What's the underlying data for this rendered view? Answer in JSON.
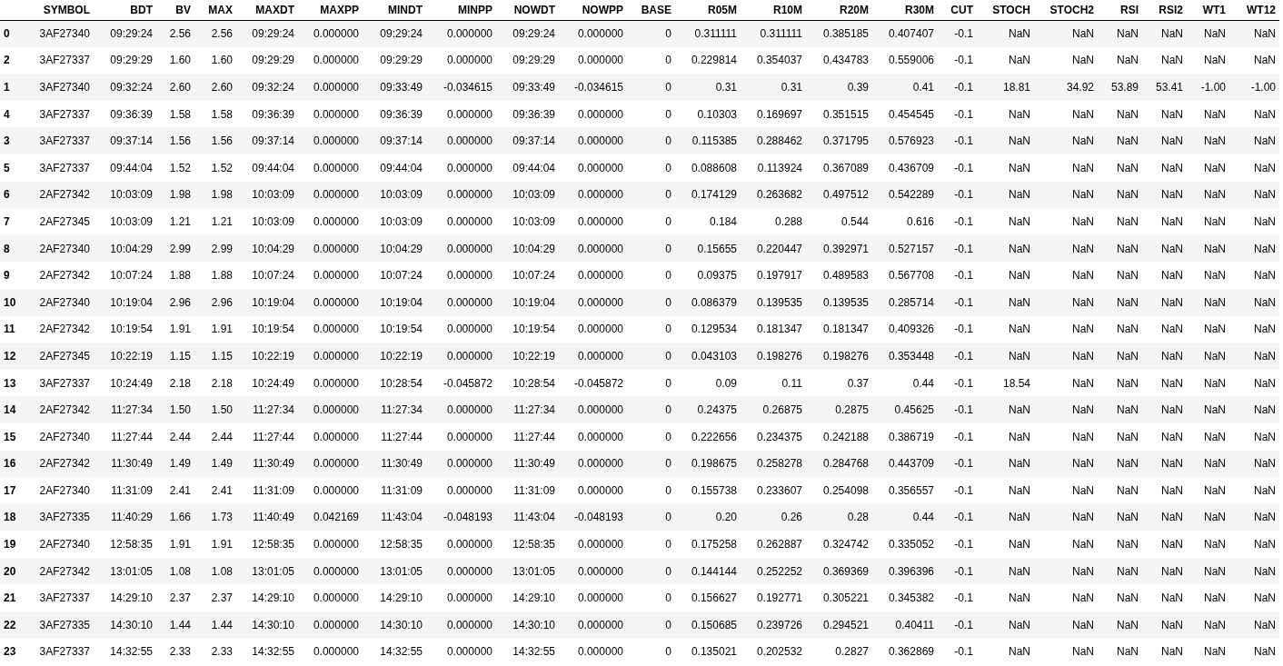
{
  "table": {
    "columns": [
      "SYMBOL",
      "BDT",
      "BV",
      "MAX",
      "MAXDT",
      "MAXPP",
      "MINDT",
      "MINPP",
      "NOWDT",
      "NOWPP",
      "BASE",
      "R05M",
      "R10M",
      "R20M",
      "R30M",
      "CUT",
      "STOCH",
      "STOCH2",
      "RSI",
      "RSI2",
      "WT1",
      "WT12"
    ],
    "rows": [
      {
        "index": "0",
        "cells": [
          "3AF27340",
          "09:29:24",
          "2.56",
          "2.56",
          "09:29:24",
          "0.000000",
          "09:29:24",
          "0.000000",
          "09:29:24",
          "0.000000",
          "0",
          "0.311111",
          "0.311111",
          "0.385185",
          "0.407407",
          "-0.1",
          "NaN",
          "NaN",
          "NaN",
          "NaN",
          "NaN",
          "NaN"
        ]
      },
      {
        "index": "2",
        "cells": [
          "3AF27337",
          "09:29:29",
          "1.60",
          "1.60",
          "09:29:29",
          "0.000000",
          "09:29:29",
          "0.000000",
          "09:29:29",
          "0.000000",
          "0",
          "0.229814",
          "0.354037",
          "0.434783",
          "0.559006",
          "-0.1",
          "NaN",
          "NaN",
          "NaN",
          "NaN",
          "NaN",
          "NaN"
        ]
      },
      {
        "index": "1",
        "cells": [
          "3AF27340",
          "09:32:24",
          "2.60",
          "2.60",
          "09:32:24",
          "0.000000",
          "09:33:49",
          "-0.034615",
          "09:33:49",
          "-0.034615",
          "0",
          "0.31",
          "0.31",
          "0.39",
          "0.41",
          "-0.1",
          "18.81",
          "34.92",
          "53.89",
          "53.41",
          "-1.00",
          "-1.00"
        ]
      },
      {
        "index": "4",
        "cells": [
          "3AF27337",
          "09:36:39",
          "1.58",
          "1.58",
          "09:36:39",
          "0.000000",
          "09:36:39",
          "0.000000",
          "09:36:39",
          "0.000000",
          "0",
          "0.10303",
          "0.169697",
          "0.351515",
          "0.454545",
          "-0.1",
          "NaN",
          "NaN",
          "NaN",
          "NaN",
          "NaN",
          "NaN"
        ]
      },
      {
        "index": "3",
        "cells": [
          "3AF27337",
          "09:37:14",
          "1.56",
          "1.56",
          "09:37:14",
          "0.000000",
          "09:37:14",
          "0.000000",
          "09:37:14",
          "0.000000",
          "0",
          "0.115385",
          "0.288462",
          "0.371795",
          "0.576923",
          "-0.1",
          "NaN",
          "NaN",
          "NaN",
          "NaN",
          "NaN",
          "NaN"
        ]
      },
      {
        "index": "5",
        "cells": [
          "3AF27337",
          "09:44:04",
          "1.52",
          "1.52",
          "09:44:04",
          "0.000000",
          "09:44:04",
          "0.000000",
          "09:44:04",
          "0.000000",
          "0",
          "0.088608",
          "0.113924",
          "0.367089",
          "0.436709",
          "-0.1",
          "NaN",
          "NaN",
          "NaN",
          "NaN",
          "NaN",
          "NaN"
        ]
      },
      {
        "index": "6",
        "cells": [
          "2AF27342",
          "10:03:09",
          "1.98",
          "1.98",
          "10:03:09",
          "0.000000",
          "10:03:09",
          "0.000000",
          "10:03:09",
          "0.000000",
          "0",
          "0.174129",
          "0.263682",
          "0.497512",
          "0.542289",
          "-0.1",
          "NaN",
          "NaN",
          "NaN",
          "NaN",
          "NaN",
          "NaN"
        ]
      },
      {
        "index": "7",
        "cells": [
          "2AF27345",
          "10:03:09",
          "1.21",
          "1.21",
          "10:03:09",
          "0.000000",
          "10:03:09",
          "0.000000",
          "10:03:09",
          "0.000000",
          "0",
          "0.184",
          "0.288",
          "0.544",
          "0.616",
          "-0.1",
          "NaN",
          "NaN",
          "NaN",
          "NaN",
          "NaN",
          "NaN"
        ]
      },
      {
        "index": "8",
        "cells": [
          "2AF27340",
          "10:04:29",
          "2.99",
          "2.99",
          "10:04:29",
          "0.000000",
          "10:04:29",
          "0.000000",
          "10:04:29",
          "0.000000",
          "0",
          "0.15655",
          "0.220447",
          "0.392971",
          "0.527157",
          "-0.1",
          "NaN",
          "NaN",
          "NaN",
          "NaN",
          "NaN",
          "NaN"
        ]
      },
      {
        "index": "9",
        "cells": [
          "2AF27342",
          "10:07:24",
          "1.88",
          "1.88",
          "10:07:24",
          "0.000000",
          "10:07:24",
          "0.000000",
          "10:07:24",
          "0.000000",
          "0",
          "0.09375",
          "0.197917",
          "0.489583",
          "0.567708",
          "-0.1",
          "NaN",
          "NaN",
          "NaN",
          "NaN",
          "NaN",
          "NaN"
        ]
      },
      {
        "index": "10",
        "cells": [
          "2AF27340",
          "10:19:04",
          "2.96",
          "2.96",
          "10:19:04",
          "0.000000",
          "10:19:04",
          "0.000000",
          "10:19:04",
          "0.000000",
          "0",
          "0.086379",
          "0.139535",
          "0.139535",
          "0.285714",
          "-0.1",
          "NaN",
          "NaN",
          "NaN",
          "NaN",
          "NaN",
          "NaN"
        ]
      },
      {
        "index": "11",
        "cells": [
          "2AF27342",
          "10:19:54",
          "1.91",
          "1.91",
          "10:19:54",
          "0.000000",
          "10:19:54",
          "0.000000",
          "10:19:54",
          "0.000000",
          "0",
          "0.129534",
          "0.181347",
          "0.181347",
          "0.409326",
          "-0.1",
          "NaN",
          "NaN",
          "NaN",
          "NaN",
          "NaN",
          "NaN"
        ]
      },
      {
        "index": "12",
        "cells": [
          "2AF27345",
          "10:22:19",
          "1.15",
          "1.15",
          "10:22:19",
          "0.000000",
          "10:22:19",
          "0.000000",
          "10:22:19",
          "0.000000",
          "0",
          "0.043103",
          "0.198276",
          "0.198276",
          "0.353448",
          "-0.1",
          "NaN",
          "NaN",
          "NaN",
          "NaN",
          "NaN",
          "NaN"
        ]
      },
      {
        "index": "13",
        "cells": [
          "3AF27337",
          "10:24:49",
          "2.18",
          "2.18",
          "10:24:49",
          "0.000000",
          "10:28:54",
          "-0.045872",
          "10:28:54",
          "-0.045872",
          "0",
          "0.09",
          "0.11",
          "0.37",
          "0.44",
          "-0.1",
          "18.54",
          "NaN",
          "NaN",
          "NaN",
          "NaN",
          "NaN"
        ]
      },
      {
        "index": "14",
        "cells": [
          "2AF27342",
          "11:27:34",
          "1.50",
          "1.50",
          "11:27:34",
          "0.000000",
          "11:27:34",
          "0.000000",
          "11:27:34",
          "0.000000",
          "0",
          "0.24375",
          "0.26875",
          "0.2875",
          "0.45625",
          "-0.1",
          "NaN",
          "NaN",
          "NaN",
          "NaN",
          "NaN",
          "NaN"
        ]
      },
      {
        "index": "15",
        "cells": [
          "2AF27340",
          "11:27:44",
          "2.44",
          "2.44",
          "11:27:44",
          "0.000000",
          "11:27:44",
          "0.000000",
          "11:27:44",
          "0.000000",
          "0",
          "0.222656",
          "0.234375",
          "0.242188",
          "0.386719",
          "-0.1",
          "NaN",
          "NaN",
          "NaN",
          "NaN",
          "NaN",
          "NaN"
        ]
      },
      {
        "index": "16",
        "cells": [
          "2AF27342",
          "11:30:49",
          "1.49",
          "1.49",
          "11:30:49",
          "0.000000",
          "11:30:49",
          "0.000000",
          "11:30:49",
          "0.000000",
          "0",
          "0.198675",
          "0.258278",
          "0.284768",
          "0.443709",
          "-0.1",
          "NaN",
          "NaN",
          "NaN",
          "NaN",
          "NaN",
          "NaN"
        ]
      },
      {
        "index": "17",
        "cells": [
          "2AF27340",
          "11:31:09",
          "2.41",
          "2.41",
          "11:31:09",
          "0.000000",
          "11:31:09",
          "0.000000",
          "11:31:09",
          "0.000000",
          "0",
          "0.155738",
          "0.233607",
          "0.254098",
          "0.356557",
          "-0.1",
          "NaN",
          "NaN",
          "NaN",
          "NaN",
          "NaN",
          "NaN"
        ]
      },
      {
        "index": "18",
        "cells": [
          "3AF27335",
          "11:40:29",
          "1.66",
          "1.73",
          "11:40:49",
          "0.042169",
          "11:43:04",
          "-0.048193",
          "11:43:04",
          "-0.048193",
          "0",
          "0.20",
          "0.26",
          "0.28",
          "0.44",
          "-0.1",
          "NaN",
          "NaN",
          "NaN",
          "NaN",
          "NaN",
          "NaN"
        ]
      },
      {
        "index": "19",
        "cells": [
          "2AF27340",
          "12:58:35",
          "1.91",
          "1.91",
          "12:58:35",
          "0.000000",
          "12:58:35",
          "0.000000",
          "12:58:35",
          "0.000000",
          "0",
          "0.175258",
          "0.262887",
          "0.324742",
          "0.335052",
          "-0.1",
          "NaN",
          "NaN",
          "NaN",
          "NaN",
          "NaN",
          "NaN"
        ]
      },
      {
        "index": "20",
        "cells": [
          "2AF27342",
          "13:01:05",
          "1.08",
          "1.08",
          "13:01:05",
          "0.000000",
          "13:01:05",
          "0.000000",
          "13:01:05",
          "0.000000",
          "0",
          "0.144144",
          "0.252252",
          "0.369369",
          "0.396396",
          "-0.1",
          "NaN",
          "NaN",
          "NaN",
          "NaN",
          "NaN",
          "NaN"
        ]
      },
      {
        "index": "21",
        "cells": [
          "3AF27337",
          "14:29:10",
          "2.37",
          "2.37",
          "14:29:10",
          "0.000000",
          "14:29:10",
          "0.000000",
          "14:29:10",
          "0.000000",
          "0",
          "0.156627",
          "0.192771",
          "0.305221",
          "0.345382",
          "-0.1",
          "NaN",
          "NaN",
          "NaN",
          "NaN",
          "NaN",
          "NaN"
        ]
      },
      {
        "index": "22",
        "cells": [
          "3AF27335",
          "14:30:10",
          "1.44",
          "1.44",
          "14:30:10",
          "0.000000",
          "14:30:10",
          "0.000000",
          "14:30:10",
          "0.000000",
          "0",
          "0.150685",
          "0.239726",
          "0.294521",
          "0.40411",
          "-0.1",
          "NaN",
          "NaN",
          "NaN",
          "NaN",
          "NaN",
          "NaN"
        ]
      },
      {
        "index": "23",
        "cells": [
          "3AF27337",
          "14:32:55",
          "2.33",
          "2.33",
          "14:32:55",
          "0.000000",
          "14:32:55",
          "0.000000",
          "14:32:55",
          "0.000000",
          "0",
          "0.135021",
          "0.202532",
          "0.2827",
          "0.362869",
          "-0.1",
          "NaN",
          "NaN",
          "NaN",
          "NaN",
          "NaN",
          "NaN"
        ]
      }
    ]
  }
}
